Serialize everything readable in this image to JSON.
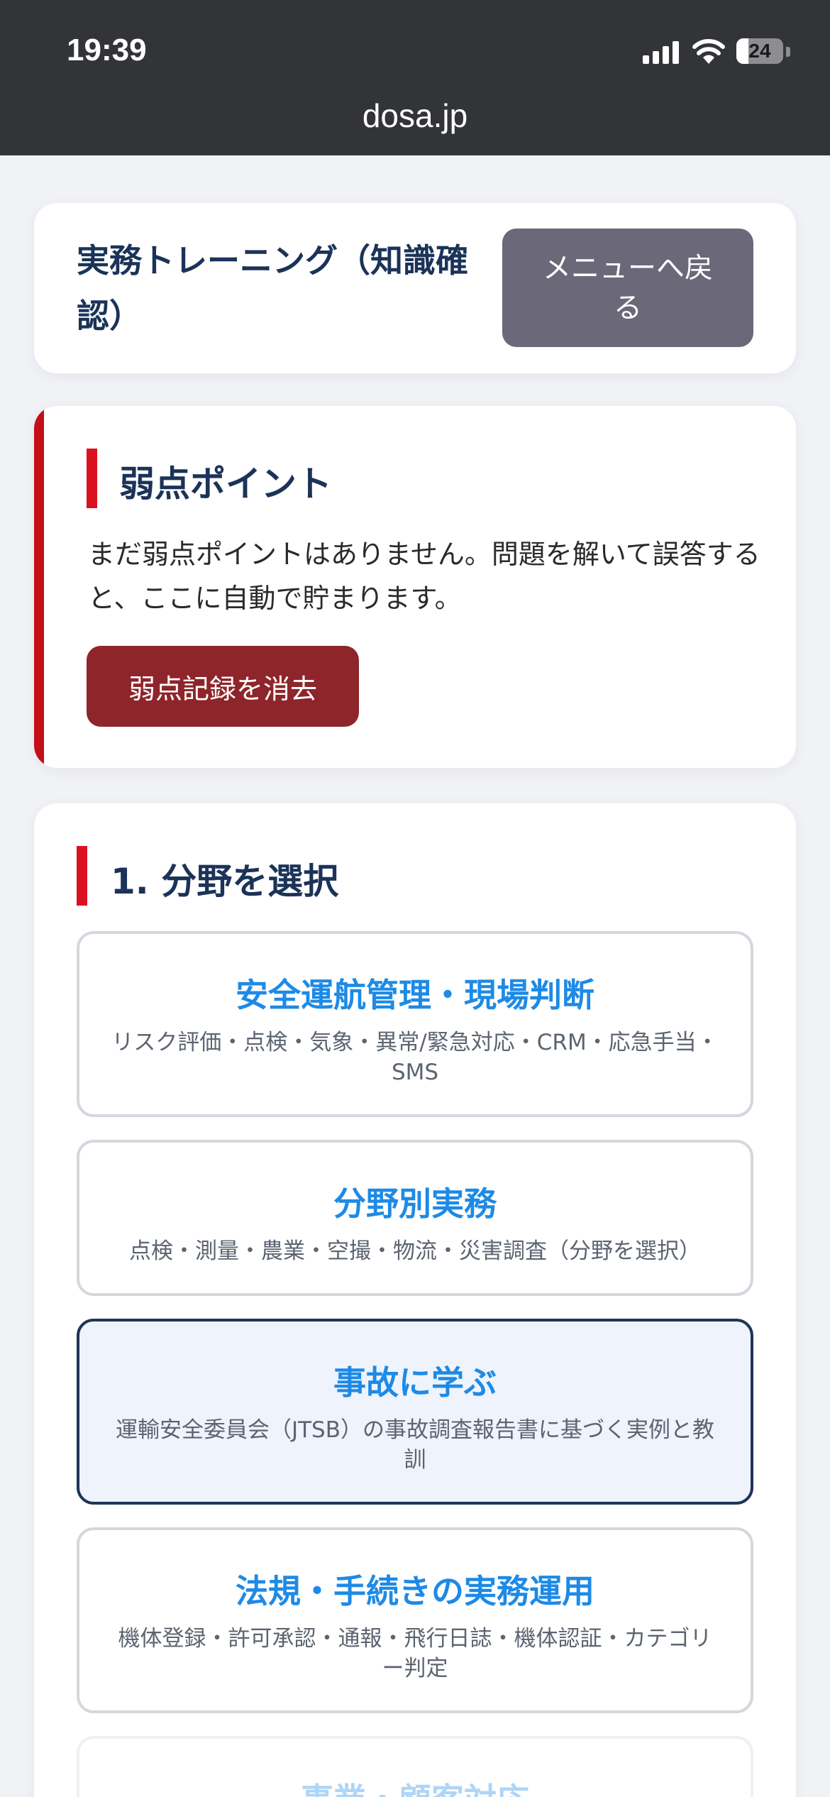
{
  "status_bar": {
    "time": "19:39",
    "battery": "24"
  },
  "browser": {
    "url": "dosa.jp"
  },
  "header": {
    "title": "実務トレーニング（知識確認）",
    "menu_button": "メニューへ戻る"
  },
  "weak_points": {
    "title": "弱点ポイント",
    "message": "まだ弱点ポイントはありません。問題を解いて誤答すると、ここに自動で貯まります。",
    "clear_button": "弱点記録を消去"
  },
  "field_select": {
    "title": "1. 分野を選択",
    "options": [
      {
        "title": "安全運航管理・現場判断",
        "desc": "リスク評価・点検・気象・異常/緊急対応・CRM・応急手当・SMS",
        "selected": false
      },
      {
        "title": "分野別実務",
        "desc": "点検・測量・農業・空撮・物流・災害調査（分野を選択）",
        "selected": false
      },
      {
        "title": "事故に学ぶ",
        "desc": "運輸安全委員会（JTSB）の事故調査報告書に基づく実例と教訓",
        "selected": true
      },
      {
        "title": "法規・手続きの実務運用",
        "desc": "機体登録・許可承認・通報・飛行日誌・機体認証・カテゴリー判定",
        "selected": false
      },
      {
        "title": "事業・顧客対応",
        "desc": "",
        "selected": false
      }
    ]
  },
  "colors": {
    "accent_red": "#dc1120",
    "link_blue": "#1e8ae6",
    "navy": "#1b3358",
    "danger_button": "#8e252b",
    "menu_button": "#6b6879"
  }
}
